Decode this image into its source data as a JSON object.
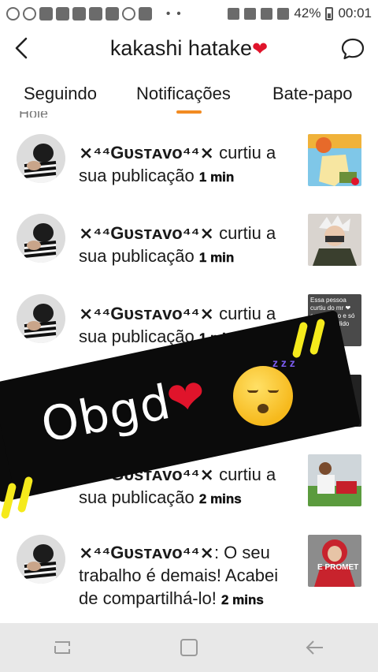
{
  "status_bar": {
    "battery": "42%",
    "time": "00:01",
    "dots": "• •"
  },
  "header": {
    "title": "kakashi hatake",
    "title_heart": "❤"
  },
  "tabs": [
    {
      "label": "Seguindo"
    },
    {
      "label": "Notificações",
      "active": true
    },
    {
      "label": "Bate-papo"
    }
  ],
  "colors": {
    "accent": "#f28b22",
    "heart": "#e0142b"
  },
  "notifications": [
    {
      "user": "⨯⁴⁴Gᴜѕтᴀᴠᴏ⁴⁴⨯",
      "action": " curtiu a sua publicação ",
      "time": "1 min"
    },
    {
      "user": "⨯⁴⁴Gᴜѕтᴀᴠᴏ⁴⁴⨯",
      "action": " curtiu a sua publicação ",
      "time": "1 min"
    },
    {
      "user": "⨯⁴⁴Gᴜѕтᴀᴠᴏ⁴⁴⨯",
      "action": " curtiu a sua publicação ",
      "time": "1 min"
    },
    {
      "user": "",
      "action": "",
      "time": ""
    },
    {
      "user": "⨯⁴⁴Gᴜѕтᴀᴠᴏ⁴⁴⨯",
      "action": " curtiu a sua publicação ",
      "time": "2 mins"
    },
    {
      "user": "⨯⁴⁴Gᴜѕтᴀᴠᴏ⁴⁴⨯",
      "action": ": O seu trabalho é demais! Acabei de compartilhá-lo! ",
      "time": "2 mins"
    }
  ],
  "thumb_texts": {
    "t3": "Essa pessoa curtiu do mr ❤ sentimento e só tmnc u iludido",
    "t6": "E PROMET"
  },
  "sticker": {
    "text": "Obgd",
    "heart": "❤",
    "zzz": "z z z"
  },
  "partial_text": "Hoje"
}
